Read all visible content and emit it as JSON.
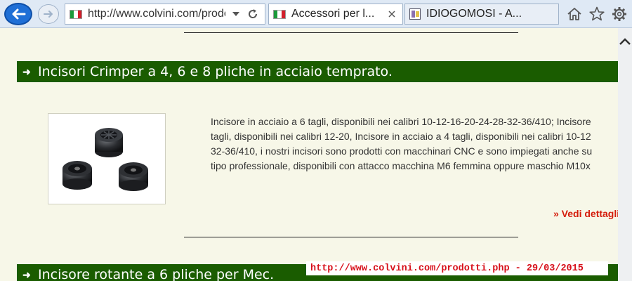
{
  "browser": {
    "address": "http://www.colvini.com/prodotti.php",
    "tabs": [
      {
        "title": "Accessori per l...",
        "active": true
      },
      {
        "title": "IDIOGOMOSI - A..."
      }
    ],
    "icons": {
      "back": "arrow-left-icon",
      "forward": "arrow-right-icon",
      "dropdown": "chevron-down-icon",
      "refresh": "refresh-icon",
      "home": "home-icon",
      "favorites": "star-icon",
      "settings": "gear-icon"
    }
  },
  "page": {
    "sections": [
      {
        "title": "Incisori Crimper a 4, 6 e 8 pliche in acciaio temprato.",
        "description_lines": [
          "Incisore in acciaio a 6 tagli, disponibili nei calibri 10-12-16-20-24-28-32-36/410; Incisore",
          "tagli, disponibili nei calibri 12-20, Incisore in acciaio a 4 tagli, disponibili nei calibri 10-12",
          "32-36/410, i nostri incisori sono prodotti con macchinari CNC e sono impiegati anche su",
          "tipo professionale, disponibili con attacco macchina M6 femmina oppure maschio M10x"
        ],
        "more_link": "» Vedi dettagli"
      },
      {
        "title": "Incisore rotante a 6 pliche per Mec."
      }
    ],
    "stamp": "http://www.colvini.com/prodotti.php - 29/03/2015"
  },
  "colors": {
    "section_bar": "#1a5c00",
    "link_red": "#d41c0b",
    "page_bg": "#f7f7e8"
  }
}
